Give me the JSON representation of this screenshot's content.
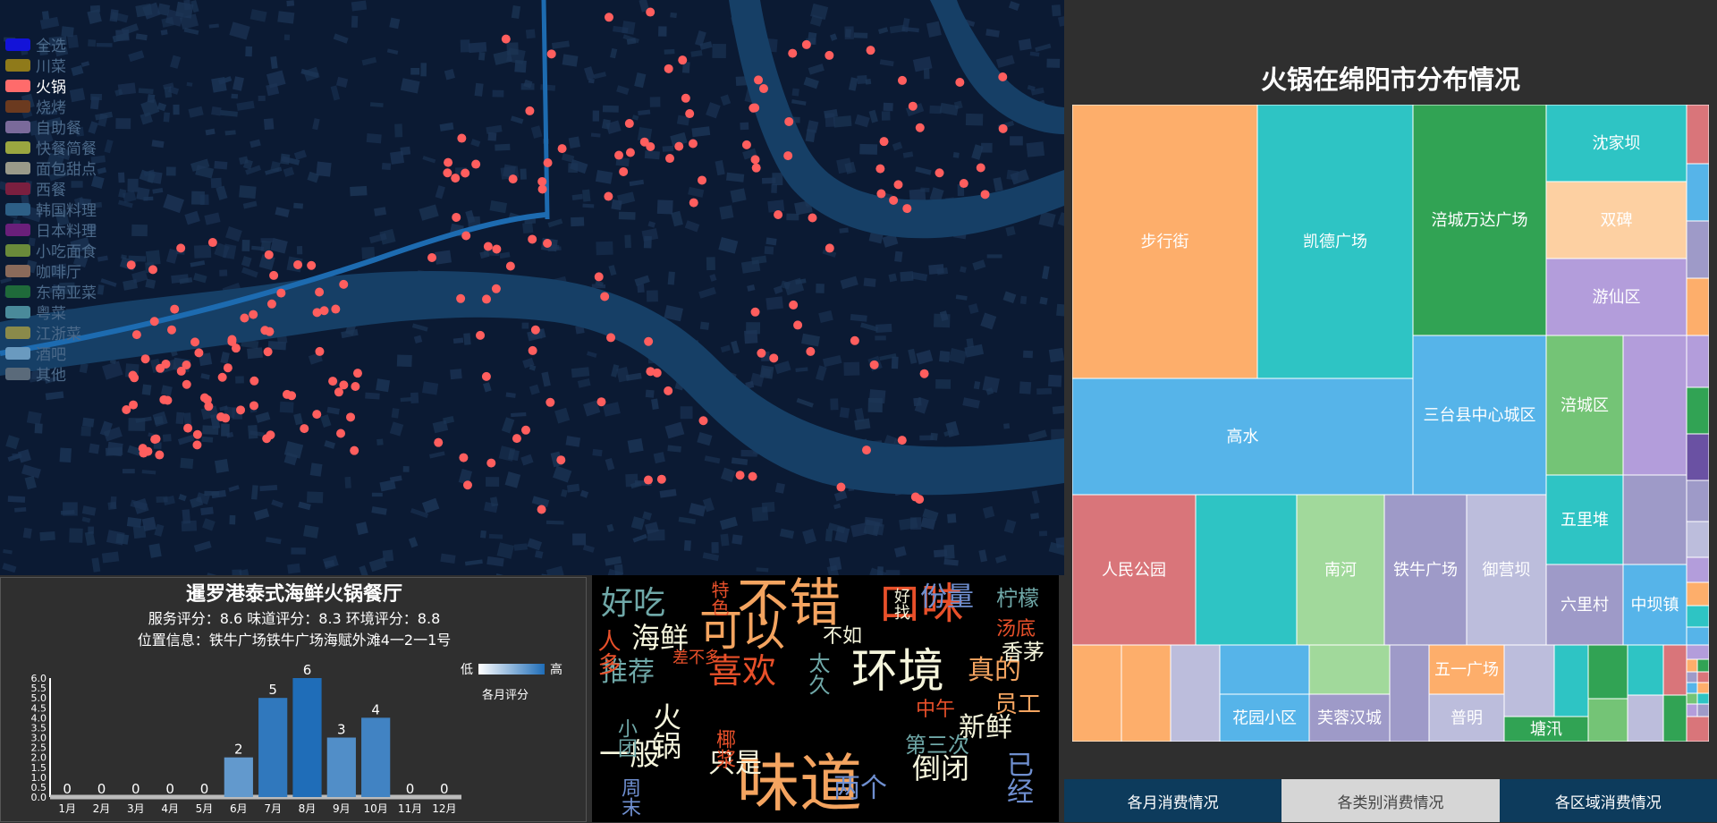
{
  "legend": {
    "items": [
      {
        "label": "全选",
        "color": "#1313d8",
        "active": false
      },
      {
        "label": "川菜",
        "color": "#8f7a1a",
        "active": false
      },
      {
        "label": "火锅",
        "color": "#ff6b6b",
        "active": true
      },
      {
        "label": "烧烤",
        "color": "#6b3a1f",
        "active": false
      },
      {
        "label": "自助餐",
        "color": "#7a6a9a",
        "active": false
      },
      {
        "label": "快餐简餐",
        "color": "#9aa640",
        "active": false
      },
      {
        "label": "面包甜点",
        "color": "#9a9a8a",
        "active": false
      },
      {
        "label": "西餐",
        "color": "#7a1f3f",
        "active": false
      },
      {
        "label": "韩国料理",
        "color": "#2d5f86",
        "active": false
      },
      {
        "label": "日本料理",
        "color": "#6a1f7a",
        "active": false
      },
      {
        "label": "小吃面食",
        "color": "#6a8a3a",
        "active": false
      },
      {
        "label": "咖啡厅",
        "color": "#8a6a5a",
        "active": false
      },
      {
        "label": "东南亚菜",
        "color": "#1f6a3a",
        "active": false
      },
      {
        "label": "粤菜",
        "color": "#4a8a9a",
        "active": false
      },
      {
        "label": "江浙菜",
        "color": "#8a8a4a",
        "active": false
      },
      {
        "label": "酒吧",
        "color": "#6a9abf",
        "active": false
      },
      {
        "label": "其他",
        "color": "#5a6a7a",
        "active": false
      }
    ]
  },
  "map": {
    "point_color": "#ff5e5e"
  },
  "restaurant": {
    "name": "暹罗港泰式海鲜火锅餐厅",
    "scores": "服务评分：8.6 味道评分：8.3 环境评分：8.8",
    "address": "位置信息：铁牛广场铁牛广场海赋外滩4一2一1号",
    "visual_map": {
      "low": "低",
      "high": "高",
      "title": "各月评分"
    }
  },
  "chart_data": {
    "type": "bar",
    "categories": [
      "1月",
      "2月",
      "3月",
      "4月",
      "5月",
      "6月",
      "7月",
      "8月",
      "9月",
      "10月",
      "11月",
      "12月"
    ],
    "values": [
      0,
      0,
      0,
      0,
      0,
      2,
      5,
      6,
      3,
      4,
      0,
      0
    ],
    "y_ticks": [
      "0.0",
      "0.5",
      "1.0",
      "1.5",
      "2.0",
      "2.5",
      "3.0",
      "3.5",
      "4.0",
      "4.5",
      "5.0",
      "5.5",
      "6.0"
    ],
    "ylim": [
      0,
      6
    ],
    "color_low": "#ffffff",
    "color_high": "#1f6db8"
  },
  "wordcloud": [
    {
      "text": "不错",
      "color": "#f4a460",
      "size": 58
    },
    {
      "text": "味道",
      "color": "#f4a460",
      "size": 70
    },
    {
      "text": "口味",
      "color": "#e8502a",
      "size": 48
    },
    {
      "text": "环境",
      "color": "#f5f5dc",
      "size": 52
    },
    {
      "text": "可以",
      "color": "#f4a460",
      "size": 48
    },
    {
      "text": "喜欢",
      "color": "#e8502a",
      "size": 38
    },
    {
      "text": "好吃",
      "color": "#6fa8a8",
      "size": 36
    },
    {
      "text": "海鲜",
      "color": "#f5f5dc",
      "size": 32
    },
    {
      "text": "推荐",
      "color": "#6fa8a8",
      "size": 30
    },
    {
      "text": "火锅",
      "color": "#f5f5dc",
      "size": 32
    },
    {
      "text": "一般",
      "color": "#f5f5dc",
      "size": 34
    },
    {
      "text": "只是",
      "color": "#f5f5dc",
      "size": 30
    },
    {
      "text": "两个",
      "color": "#6f8fd0",
      "size": 30
    },
    {
      "text": "倒闭",
      "color": "#f5f5dc",
      "size": 32
    },
    {
      "text": "已经",
      "color": "#6f8fd0",
      "size": 30
    },
    {
      "text": "新鲜",
      "color": "#f5f5dc",
      "size": 30
    },
    {
      "text": "真的",
      "color": "#f4a460",
      "size": 30
    },
    {
      "text": "员工",
      "color": "#f4a460",
      "size": 26
    },
    {
      "text": "份量",
      "color": "#6f8fd0",
      "size": 30
    },
    {
      "text": "柠檬",
      "color": "#6fa8a8",
      "size": 24
    },
    {
      "text": "汤底",
      "color": "#e8502a",
      "size": 22
    },
    {
      "text": "香茅",
      "color": "#f5f5dc",
      "size": 24
    },
    {
      "text": "不如",
      "color": "#f5f5dc",
      "size": 22
    },
    {
      "text": "差不多",
      "color": "#e8502a",
      "size": 18
    },
    {
      "text": "太久",
      "color": "#6fa8a8",
      "size": 24
    },
    {
      "text": "中午",
      "color": "#e8502a",
      "size": 22
    },
    {
      "text": "第三次",
      "color": "#6fa8a8",
      "size": 24
    },
    {
      "text": "人多",
      "color": "#e8502a",
      "size": 26
    },
    {
      "text": "特色",
      "color": "#e8502a",
      "size": 20
    },
    {
      "text": "好找",
      "color": "#f5f5dc",
      "size": 18
    },
    {
      "text": "小团",
      "color": "#6fa8a8",
      "size": 22
    },
    {
      "text": "椰浆",
      "color": "#e8502a",
      "size": 22
    },
    {
      "text": "周末",
      "color": "#6f8fd0",
      "size": 22
    }
  ],
  "treemap": {
    "title": "火锅在绵阳市分布情况",
    "labels": [
      "步行街",
      "凯德广场",
      "涪城万达广场",
      "沈家坝",
      "双碑",
      "游仙区",
      "高水",
      "三台县中心城区",
      "涪城区",
      "人民公园",
      "南河",
      "铁牛广场",
      "御营坝",
      "五里堆",
      "六里村",
      "中坝镇",
      "花园小区",
      "芙蓉汉城",
      "五一广场",
      "普明",
      "塘汛"
    ]
  },
  "tabs": [
    {
      "label": "各月消费情况",
      "active": false
    },
    {
      "label": "各类别消费情况",
      "active": true
    },
    {
      "label": "各区域消费情况",
      "active": false
    }
  ]
}
